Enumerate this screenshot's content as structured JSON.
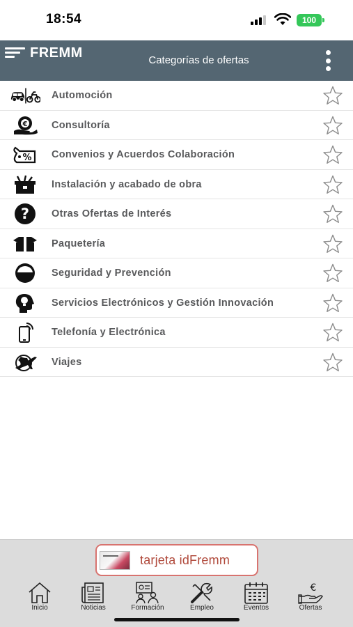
{
  "status_bar": {
    "time": "18:54",
    "battery": "100"
  },
  "header": {
    "logo_text": "FREMM",
    "title": "Categorías de ofertas"
  },
  "categories": [
    {
      "label": "Automoción",
      "icon": "car-moto-icon",
      "favorite": false
    },
    {
      "label": "Consultoría",
      "icon": "consulting-icon",
      "favorite": false
    },
    {
      "label": "Convenios y Acuerdos Colaboración",
      "icon": "discount-tag-icon",
      "favorite": false
    },
    {
      "label": "Instalación y acabado de obra",
      "icon": "toolbox-icon",
      "favorite": false
    },
    {
      "label": "Otras Ofertas de Interés",
      "icon": "question-icon",
      "favorite": false
    },
    {
      "label": "Paquetería",
      "icon": "package-icon",
      "favorite": false
    },
    {
      "label": "Seguridad y Prevención",
      "icon": "helmet-icon",
      "favorite": false
    },
    {
      "label": "Servicios Electrónicos y Gestión Innovación",
      "icon": "head-bulb-icon",
      "favorite": false
    },
    {
      "label": "Telefonía y Electrónica",
      "icon": "phone-signal-icon",
      "favorite": false
    },
    {
      "label": "Viajes",
      "icon": "airplane-globe-icon",
      "favorite": false
    }
  ],
  "promo": {
    "label": "tarjeta idFremm",
    "card_text": ""
  },
  "tabs": [
    {
      "label": "Inicio",
      "icon": "home-icon"
    },
    {
      "label": "Noticias",
      "icon": "newspaper-icon"
    },
    {
      "label": "Formación",
      "icon": "training-icon"
    },
    {
      "label": "Empleo",
      "icon": "tools-icon"
    },
    {
      "label": "Eventos",
      "icon": "calendar-icon"
    },
    {
      "label": "Ofertas",
      "icon": "euro-hand-icon"
    }
  ],
  "colors": {
    "header_bg": "#546672",
    "label_text": "#58595b",
    "promo_border": "#d8736f",
    "promo_text": "#b0493b",
    "tab_bg": "#dcdcdc",
    "battery": "#34c759"
  }
}
